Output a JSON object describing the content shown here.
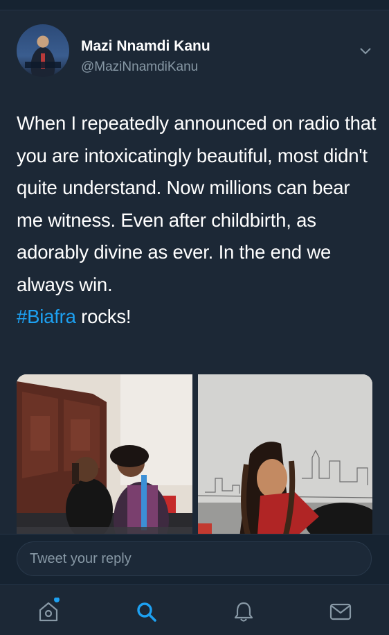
{
  "tweet": {
    "author_name": "Mazi Nnamdi Kanu",
    "author_handle": "@MaziNnamdiKanu",
    "text_before_hashtag": "When I repeatedly announced on radio that you are intoxicatingly beautiful, most didn't quite understand. Now millions can bear me witness. Even after childbirth, as adorably divine as ever. In the end we always win.",
    "hashtag": "#Biafra",
    "text_after_hashtag": " rocks!",
    "avatar_caption": "MAZI NNAMDI KANU BIAFRA",
    "media": [
      {
        "description": "man-and-woman-on-sofa-photo"
      },
      {
        "description": "woman-with-braids-city-backdrop-photo"
      }
    ]
  },
  "composer": {
    "placeholder": "Tweet your reply"
  },
  "tabs": [
    {
      "name": "home",
      "icon": "home-icon",
      "active": false,
      "has_notification_dot": true
    },
    {
      "name": "search",
      "icon": "search-icon",
      "active": true
    },
    {
      "name": "notifications",
      "icon": "bell-icon",
      "active": false
    },
    {
      "name": "messages",
      "icon": "mail-icon",
      "active": false
    }
  ],
  "colors": {
    "background": "#1c2836",
    "bar": "#162331",
    "accent": "#1da1f2",
    "secondary_text": "#8899a6"
  }
}
